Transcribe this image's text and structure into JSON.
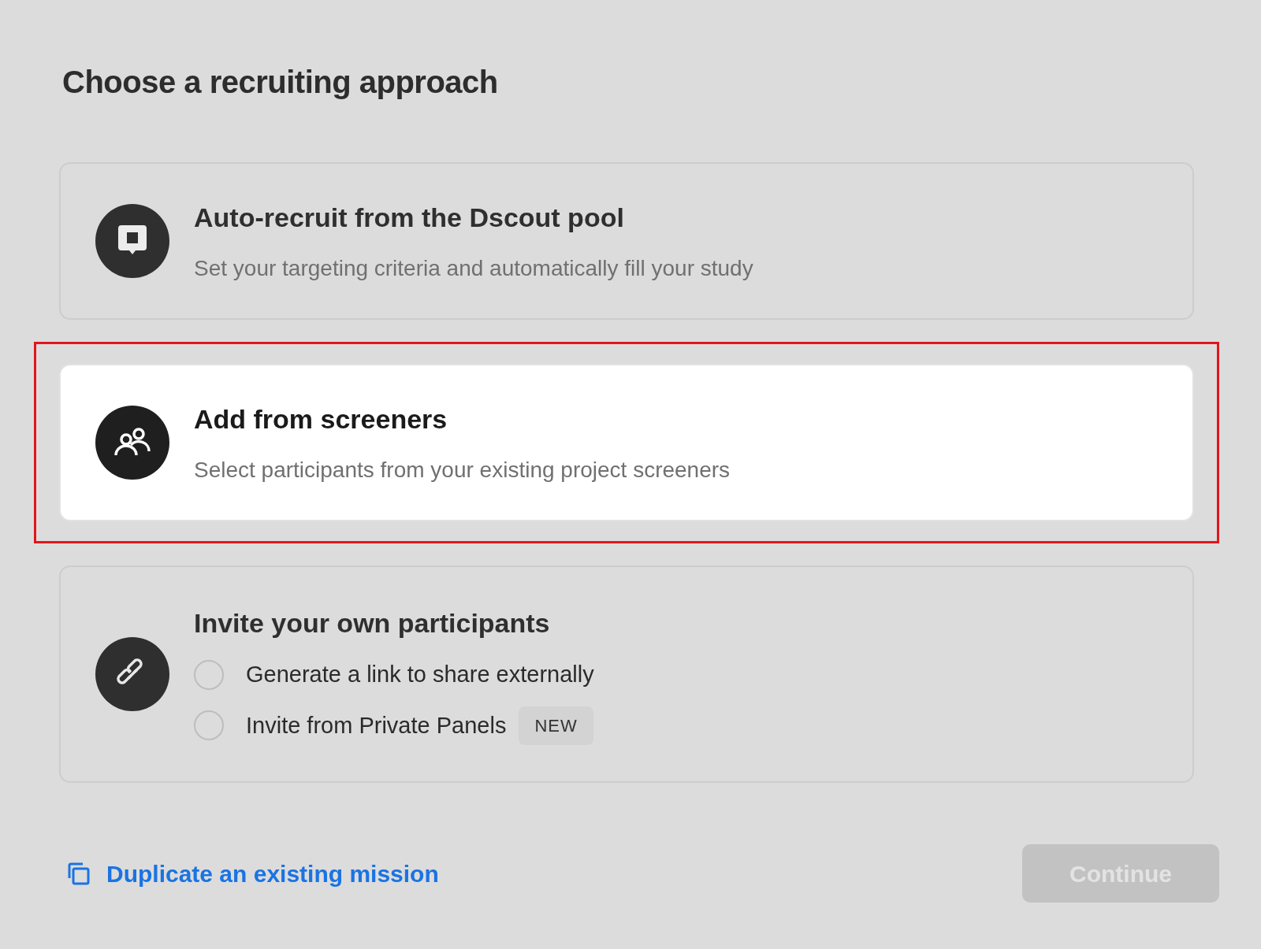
{
  "heading": "Choose a recruiting approach",
  "options": [
    {
      "kind": "pool",
      "title": "Auto-recruit from the Dscout pool",
      "description": "Set your targeting criteria and automatically fill your study",
      "highlighted": false
    },
    {
      "kind": "screeners",
      "title": "Add from screeners",
      "description": "Select participants from your existing project screeners",
      "highlighted": true
    },
    {
      "kind": "invite",
      "title": "Invite your own participants",
      "highlighted": false,
      "choices": [
        {
          "label": "Generate a link to share externally",
          "selected": false
        },
        {
          "label": "Invite from Private Panels",
          "selected": false,
          "badge": "NEW"
        }
      ]
    }
  ],
  "footer": {
    "link": "Duplicate an existing mission",
    "button": {
      "label": "Continue",
      "disabled": true
    }
  }
}
